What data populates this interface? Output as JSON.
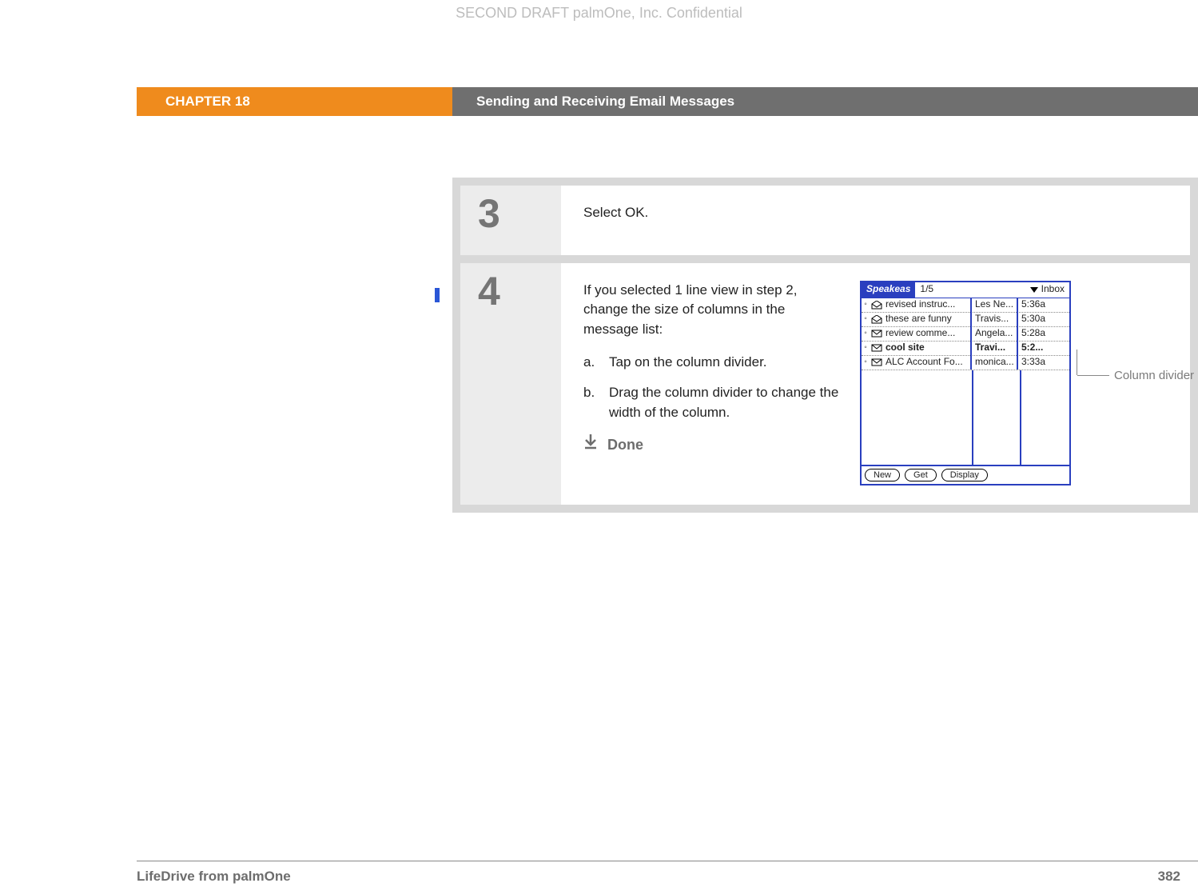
{
  "watermark": "SECOND DRAFT palmOne, Inc.  Confidential",
  "header": {
    "chapter": "CHAPTER 18",
    "title": "Sending and Receiving Email Messages"
  },
  "steps": {
    "s3": {
      "num": "3",
      "text": "Select OK."
    },
    "s4": {
      "num": "4",
      "intro": "If you selected 1 line view in step 2, change the size of columns in the message list:",
      "a_letter": "a.",
      "a_text": "Tap on the column divider.",
      "b_letter": "b.",
      "b_text": "Drag the column divider to change the width of the column.",
      "done": "Done"
    }
  },
  "callout": "Column divider",
  "palm": {
    "app": "Speakeas",
    "counter": "1/5",
    "folder": "Inbox",
    "rows": {
      "r0": {
        "subj": "revised instruc...",
        "from": "Les Ne...",
        "time": "5:36a"
      },
      "r1": {
        "subj": "these are funny",
        "from": "Travis...",
        "time": "5:30a"
      },
      "r2": {
        "subj": "review comme...",
        "from": "Angela...",
        "time": "5:28a"
      },
      "r3": {
        "subj": "cool site",
        "from": "Travi...",
        "time": "5:2..."
      },
      "r4": {
        "subj": "ALC Account Fo...",
        "from": "monica...",
        "time": "3:33a"
      }
    },
    "buttons": {
      "new": "New",
      "get": "Get",
      "display": "Display"
    }
  },
  "footer": {
    "product": "LifeDrive from palmOne",
    "page": "382"
  }
}
